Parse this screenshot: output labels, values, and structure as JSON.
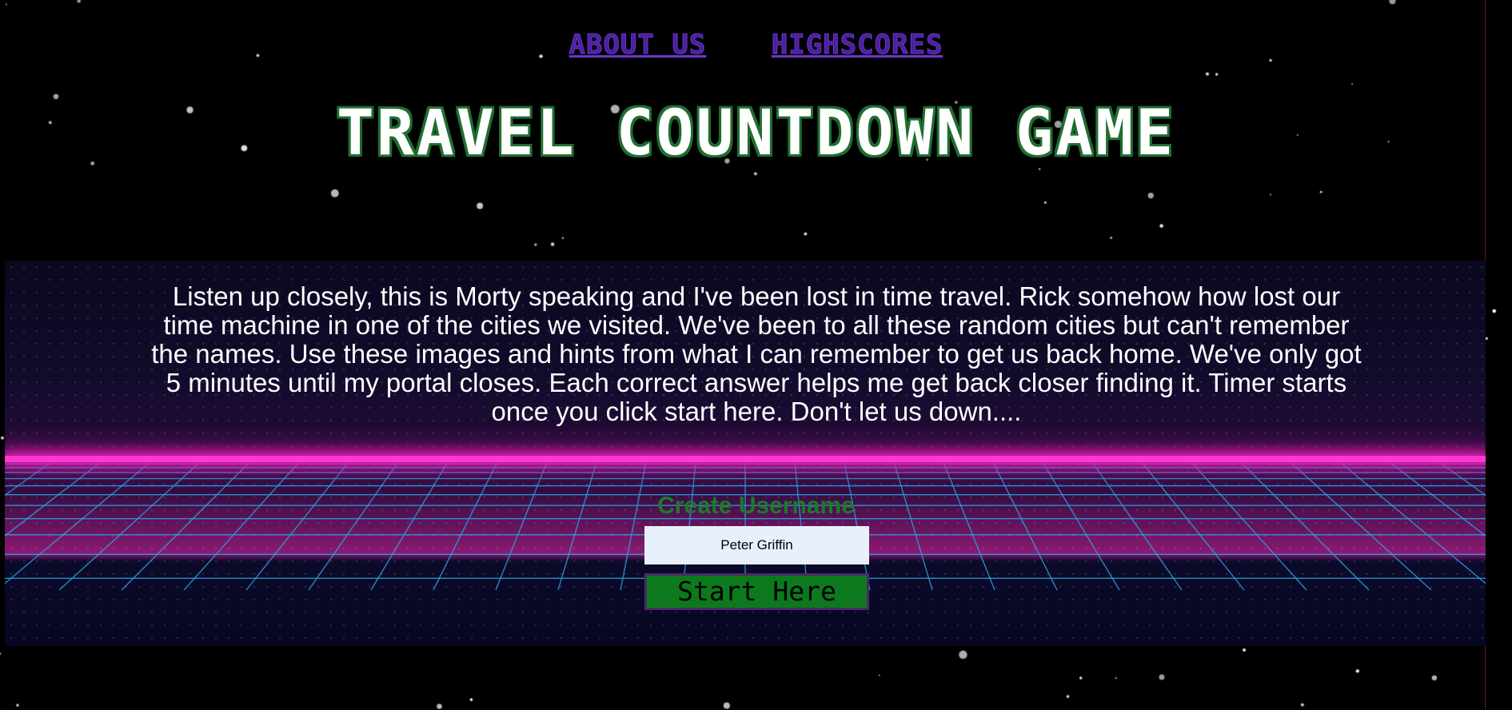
{
  "nav": {
    "about_label": "ABOUT US",
    "highscores_label": "HIGHSCORES"
  },
  "title": "TRAVEL COUNTDOWN GAME",
  "story": "Listen up closely, this is Morty speaking and I've been lost in time travel. Rick somehow how lost our time machine in one of the cities we visited. We've been to all these random cities but can't remember the names. Use these images and hints from what I can remember to get us back home. We've only got 5 minutes until my portal closes. Each correct answer helps me get back closer finding it. Timer starts once you click start here. Don't let us down....",
  "username": {
    "label": "Create Username",
    "value": "Peter Griffin"
  },
  "start_label": "Start Here",
  "colors": {
    "nav_link": "#4b1fa0",
    "title_outline": "#1f6e30",
    "horizon_glow": "#ff38d0",
    "grid_lines": "#2ba6e8",
    "start_button": "#0c7a1c",
    "username_label": "#1c7a28"
  }
}
